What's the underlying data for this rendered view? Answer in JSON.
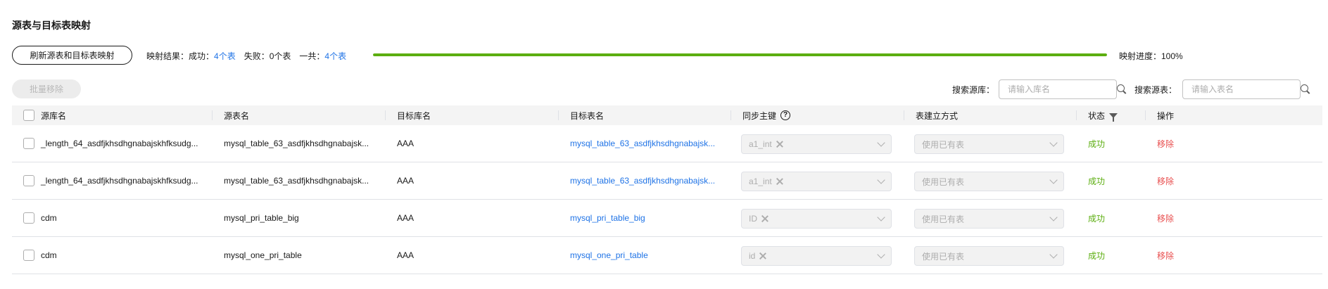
{
  "title": "源表与目标表映射",
  "toolbar": {
    "refresh_label": "刷新源表和目标表映射",
    "result_prefix": "映射结果：成功：",
    "success_count": "4个表",
    "fail_label": "失败：0个表",
    "total_prefix": "一共：",
    "total_count": "4个表",
    "progress_label": "映射进度：100%",
    "progress_value": 1.0,
    "progress_color": "#5cae10",
    "batch_remove_label": "批量移除"
  },
  "search": {
    "db_label": "搜索源库：",
    "db_placeholder": "请输入库名",
    "table_label": "搜索源表：",
    "table_placeholder": "请输入表名"
  },
  "table": {
    "headers": {
      "source_db": "源库名",
      "source_table": "源表名",
      "target_db": "目标库名",
      "target_table": "目标表名",
      "sync_key": "同步主键",
      "create_mode": "表建立方式",
      "status": "状态",
      "action": "操作"
    },
    "rows": [
      {
        "source_db": "_length_64_asdfjkhsdhgnabajskhfksudg...",
        "source_table": "mysql_table_63_asdfjkhsdhgnabajsk...",
        "target_db": "AAA",
        "target_table": "mysql_table_63_asdfjkhsdhgnabajsk...",
        "sync_key": "a1_int",
        "create_mode": "使用已有表",
        "status": "成功",
        "action": "移除"
      },
      {
        "source_db": "_length_64_asdfjkhsdhgnabajskhfksudg...",
        "source_table": "mysql_table_63_asdfjkhsdhgnabajsk...",
        "target_db": "AAA",
        "target_table": "mysql_table_63_asdfjkhsdhgnabajsk...",
        "sync_key": "a1_int",
        "create_mode": "使用已有表",
        "status": "成功",
        "action": "移除"
      },
      {
        "source_db": "cdm",
        "source_table": "mysql_pri_table_big",
        "target_db": "AAA",
        "target_table": "mysql_pri_table_big",
        "sync_key": "ID",
        "create_mode": "使用已有表",
        "status": "成功",
        "action": "移除"
      },
      {
        "source_db": "cdm",
        "source_table": "mysql_one_pri_table",
        "target_db": "AAA",
        "target_table": "mysql_one_pri_table",
        "sync_key": "id",
        "create_mode": "使用已有表",
        "status": "成功",
        "action": "移除"
      }
    ]
  },
  "colors": {
    "link": "#1f73e6",
    "success": "#5cae10",
    "danger": "#e84e4e"
  },
  "icons": [
    "search-icon",
    "help-icon",
    "filter-icon",
    "tag-close-icon",
    "chevron-down-icon",
    "checkbox"
  ]
}
